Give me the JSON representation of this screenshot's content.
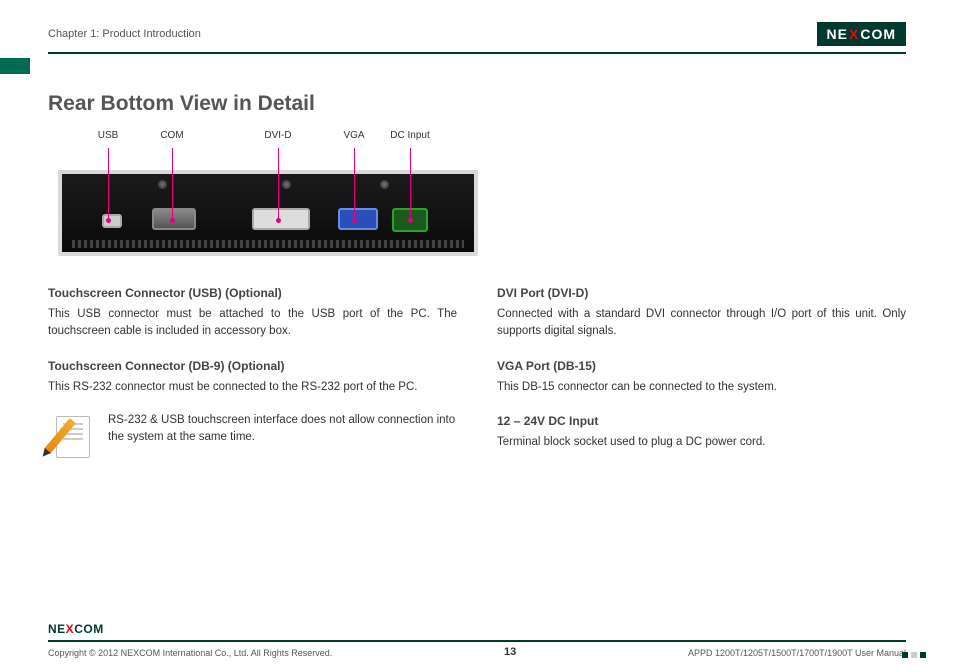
{
  "header": {
    "chapter": "Chapter 1: Product Introduction",
    "brand_pre": "NE",
    "brand_x": "X",
    "brand_post": "COM"
  },
  "title": "Rear Bottom View in Detail",
  "diagram_labels": {
    "usb": "USB",
    "com": "COM",
    "dvid": "DVI-D",
    "vga": "VGA",
    "dc": "DC Input"
  },
  "left_column": {
    "sect1": {
      "heading": "Touchscreen Connector (USB) (Optional)",
      "body": "This USB connector must be attached to the USB port of the PC. The touchscreen cable is included in accessory box."
    },
    "sect2": {
      "heading": "Touchscreen Connector (DB-9) (Optional)",
      "body": "This RS-232 connector must be connected to the RS-232 port of the PC."
    },
    "note": "RS-232 & USB touchscreen interface does not allow connection into the system at the same time."
  },
  "right_column": {
    "sect1": {
      "heading": "DVI Port (DVI-D)",
      "body": "Connected with a standard DVI connector through I/O port of this unit. Only supports digital signals."
    },
    "sect2": {
      "heading": "VGA Port (DB-15)",
      "body": "This DB-15 connector can be connected to the system."
    },
    "sect3": {
      "heading": "12 – 24V DC Input",
      "body": "Terminal block socket used to plug a DC power cord."
    }
  },
  "footer": {
    "brand_pre": "NE",
    "brand_x": "X",
    "brand_post": "COM",
    "copyright": "Copyright © 2012 NEXCOM International Co., Ltd. All Rights Reserved.",
    "page": "13",
    "manual": "APPD 1200T/1205T/1500T/1700T/1900T User Manual"
  }
}
